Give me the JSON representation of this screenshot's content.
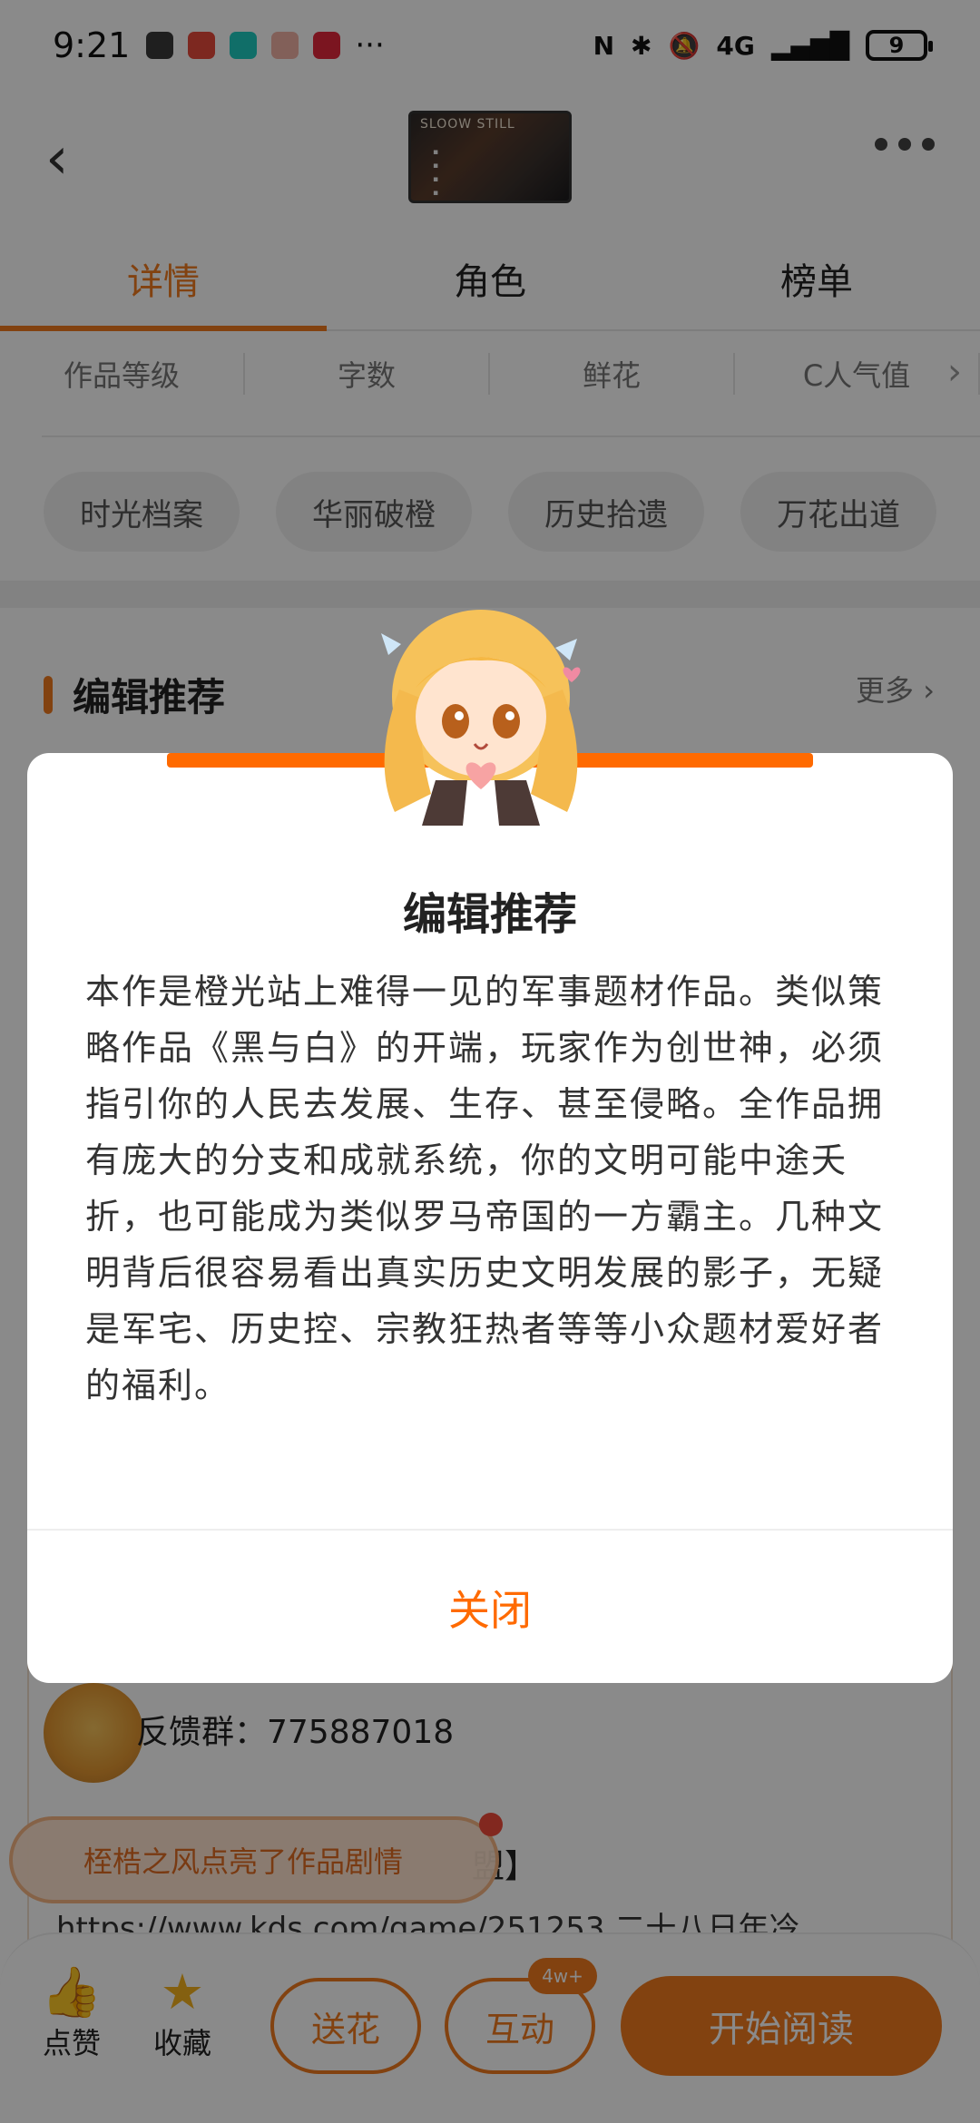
{
  "status": {
    "time": "9:21",
    "battery": "9",
    "network": "4G"
  },
  "status_icons": [
    "app-a-icon",
    "weibo-icon",
    "taptap-icon",
    "game-icon",
    "xiaohongshu-icon"
  ],
  "header": {
    "cover_title": "SLOOW STILL"
  },
  "tabs": [
    {
      "label": "详情"
    },
    {
      "label": "角色"
    },
    {
      "label": "榜单"
    }
  ],
  "stats": [
    "作品等级",
    "字数",
    "鲜花",
    "C人气值"
  ],
  "chips": [
    "时光档案",
    "华丽破橙",
    "历史拾遗",
    "万花出道"
  ],
  "section": {
    "title": "编辑推荐",
    "more": "更多"
  },
  "background": {
    "feedback": "反馈群：775887018",
    "league": "盟】",
    "link": "https://www.kds.com/game/251253 二十八日年冷"
  },
  "toast": {
    "text": "桎梏之风点亮了作品剧情"
  },
  "bottom": {
    "like": "点赞",
    "favorite": "收藏",
    "gift": "送花",
    "interact": "互动",
    "badge": "4w+",
    "start": "开始阅读"
  },
  "modal": {
    "title": "编辑推荐",
    "body": "本作是橙光站上难得一见的军事题材作品。类似策略作品《黑与白》的开端，玩家作为创世神，必须指引你的人民去发展、生存、甚至侵略。全作品拥有庞大的分支和成就系统，你的文明可能中途夭折，也可能成为类似罗马帝国的一方霸主。几种文明背后很容易看出真实历史文明发展的影子，无疑是军宅、历史控、宗教狂热者等等小众题材爱好者的福利。",
    "close": "关闭"
  },
  "colors": {
    "accent": "#f07a1e",
    "modal_accent": "#ff6a00",
    "overlay": "rgba(0,0,0,0.46)"
  }
}
